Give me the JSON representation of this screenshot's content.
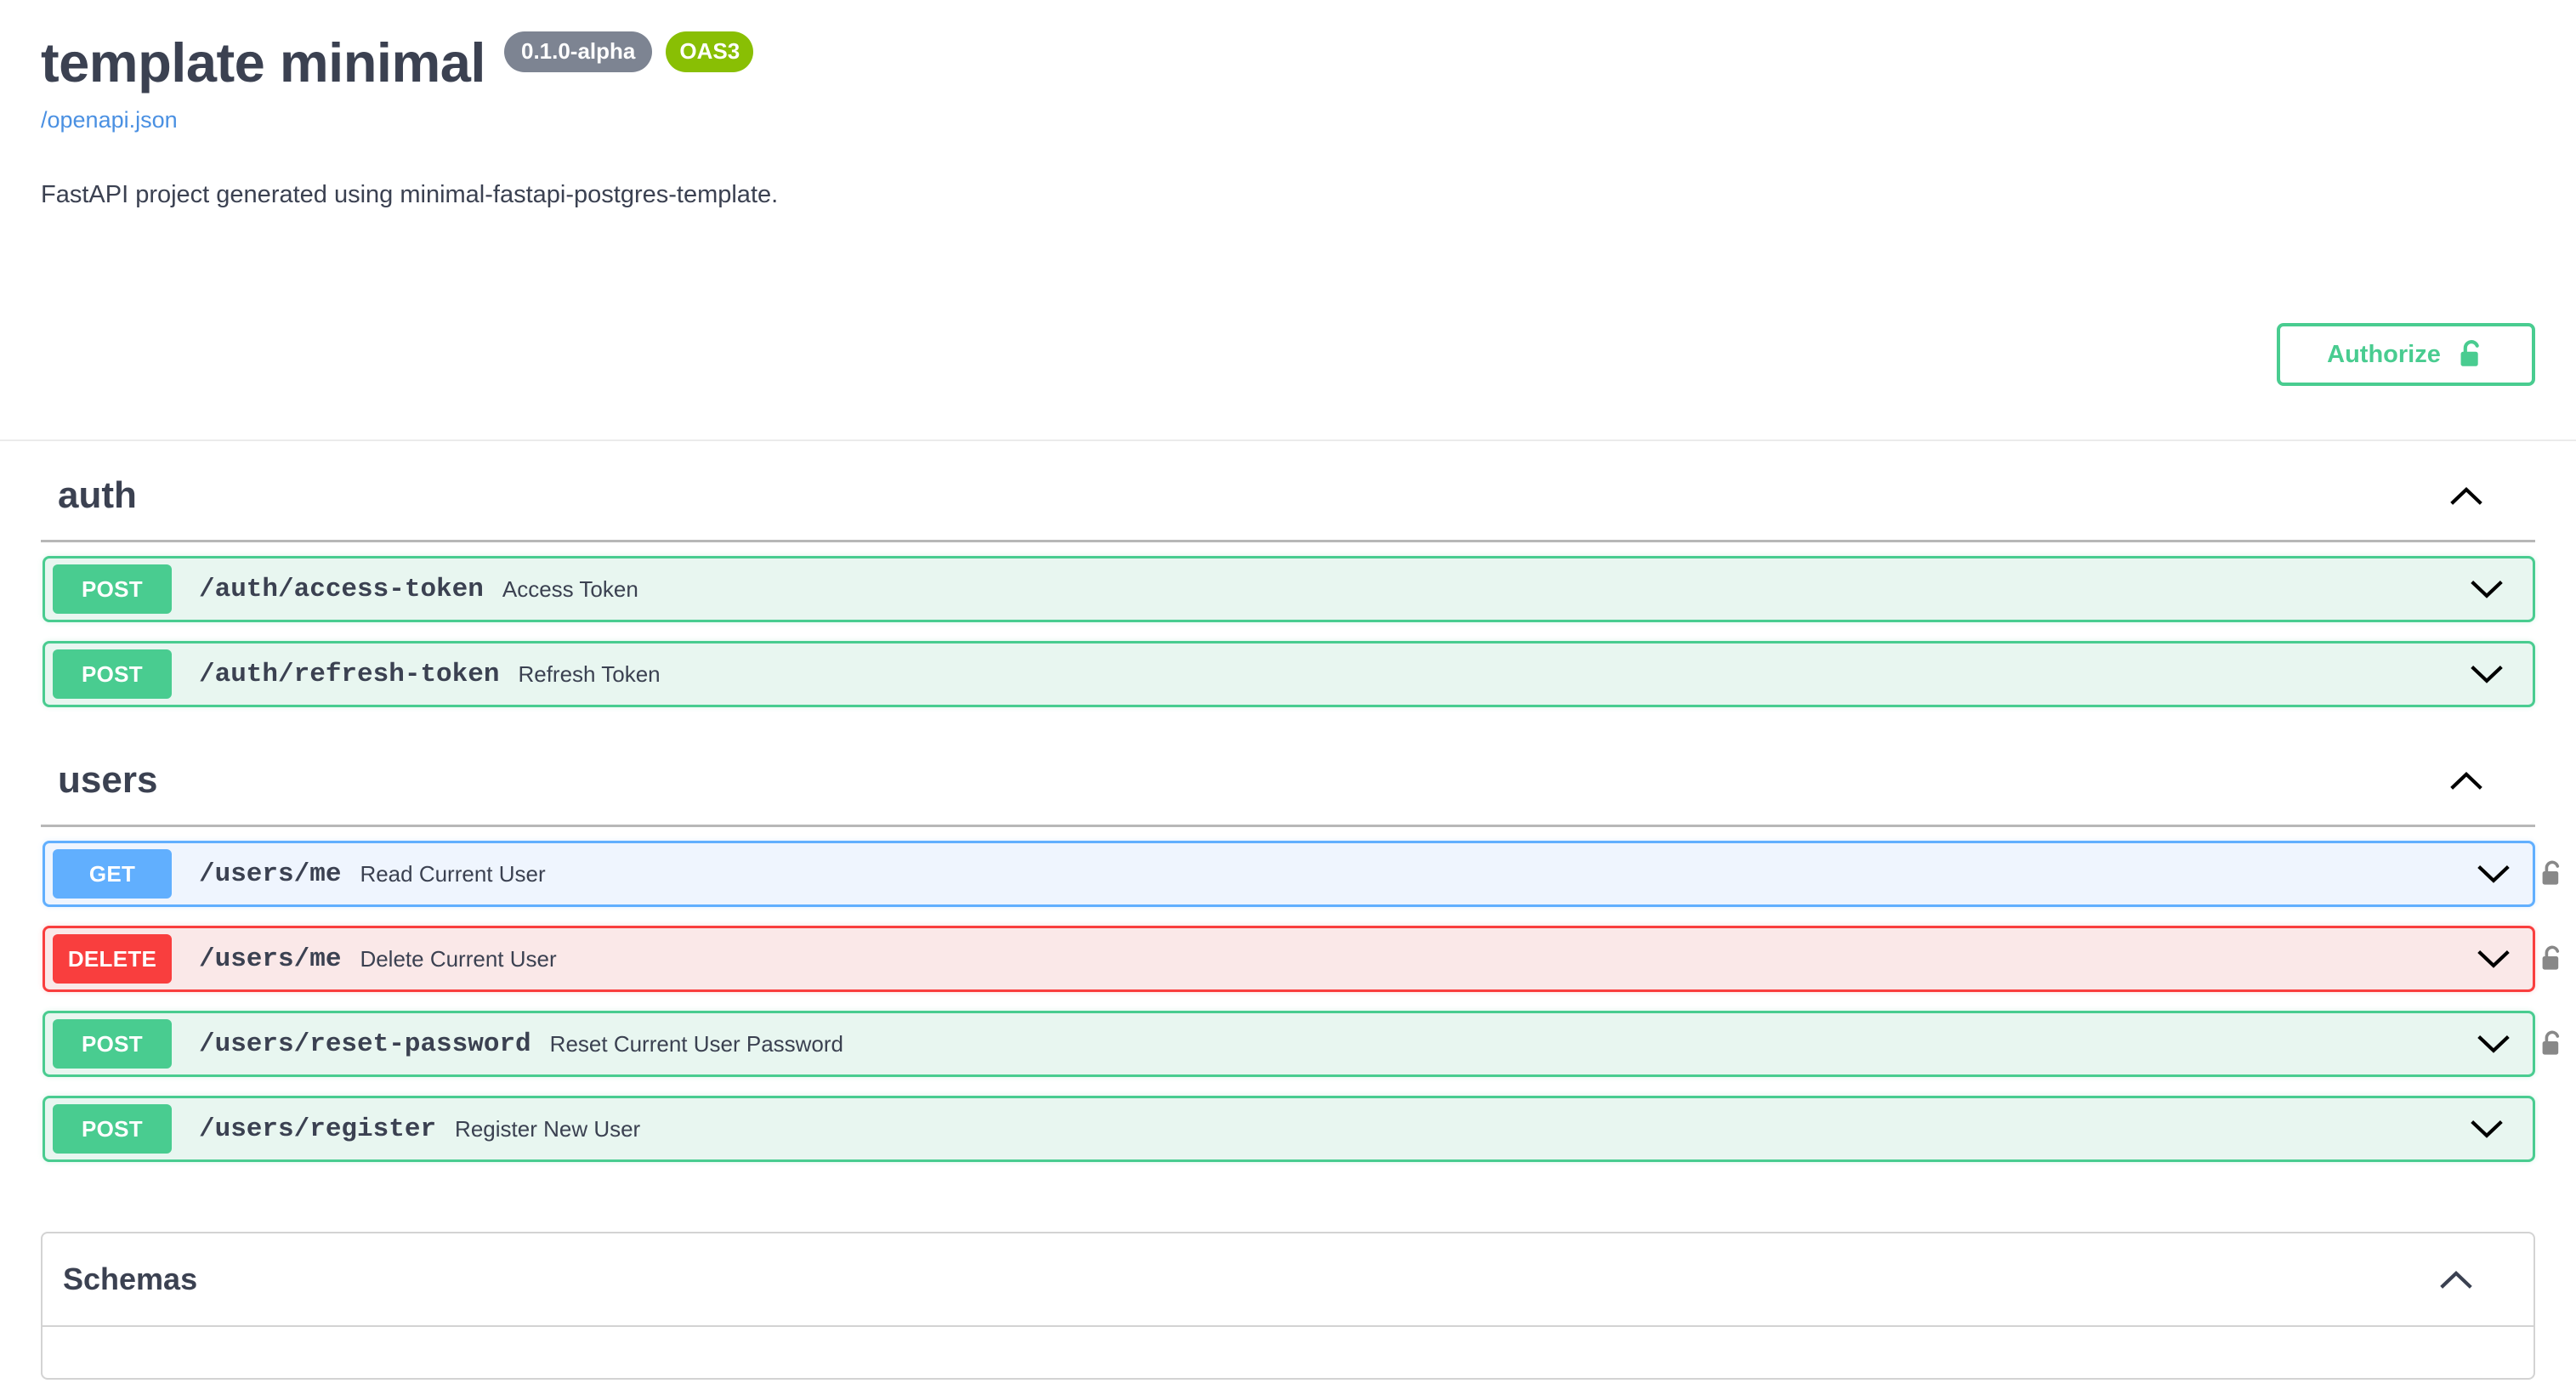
{
  "info": {
    "title": "template minimal",
    "version_badge": "0.1.0-alpha",
    "oas_badge": "OAS3",
    "spec_url": "/openapi.json",
    "description": "FastAPI project generated using minimal-fastapi-postgres-template."
  },
  "authorize": {
    "label": "Authorize",
    "icon": "unlock-icon",
    "border_color": "#49cc90",
    "text_color": "#49cc90"
  },
  "colors": {
    "post": "#49cc90",
    "get": "#61affe",
    "delete": "#f93e3e",
    "oas": "#89bf04",
    "version": "#7d8492",
    "link": "#4a90e2",
    "text": "#3b4151"
  },
  "tags": [
    {
      "name": "auth",
      "expanded": true,
      "toggle_icon": "chevron-up-icon",
      "operations": [
        {
          "method": "POST",
          "method_class": "post",
          "path": "/auth/access-token",
          "summary": "Access Token",
          "locked": false,
          "toggle_icon": "chevron-down-icon"
        },
        {
          "method": "POST",
          "method_class": "post",
          "path": "/auth/refresh-token",
          "summary": "Refresh Token",
          "locked": false,
          "toggle_icon": "chevron-down-icon"
        }
      ]
    },
    {
      "name": "users",
      "expanded": true,
      "toggle_icon": "chevron-up-icon",
      "operations": [
        {
          "method": "GET",
          "method_class": "get",
          "path": "/users/me",
          "summary": "Read Current User",
          "locked": true,
          "lock_icon": "unlock-icon",
          "toggle_icon": "chevron-down-icon"
        },
        {
          "method": "DELETE",
          "method_class": "delete",
          "path": "/users/me",
          "summary": "Delete Current User",
          "locked": true,
          "lock_icon": "unlock-icon",
          "toggle_icon": "chevron-down-icon"
        },
        {
          "method": "POST",
          "method_class": "post",
          "path": "/users/reset-password",
          "summary": "Reset Current User Password",
          "locked": true,
          "lock_icon": "unlock-icon",
          "toggle_icon": "chevron-down-icon"
        },
        {
          "method": "POST",
          "method_class": "post",
          "path": "/users/register",
          "summary": "Register New User",
          "locked": false,
          "toggle_icon": "chevron-down-icon"
        }
      ]
    }
  ],
  "models": {
    "title": "Schemas",
    "expanded": true,
    "toggle_icon": "chevron-up-icon"
  }
}
